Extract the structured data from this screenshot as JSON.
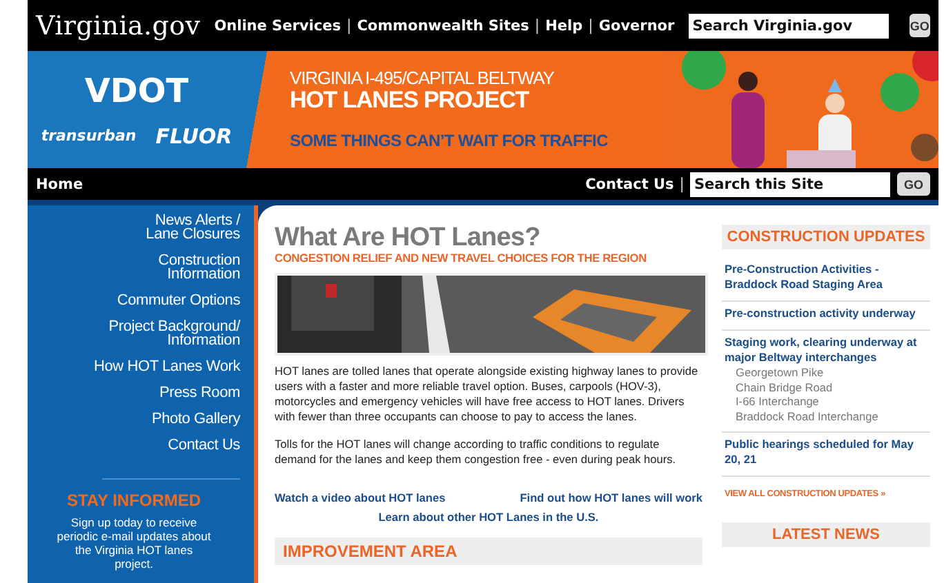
{
  "top_bar": {
    "logo": "Virginia.gov",
    "separator": "|",
    "links": [
      "Online Services",
      "Commonwealth Sites",
      "Help",
      "Governor"
    ],
    "search": {
      "placeholder": "Search Virginia.gov"
    },
    "go": "GO"
  },
  "banner": {
    "logos": [
      {
        "kind": "vdot",
        "text": "VDOT"
      },
      {
        "kind": "transurban",
        "text": "transurban"
      },
      {
        "kind": "fluor",
        "text": "FLUOR"
      }
    ],
    "kicker": "VIRGINIA I-495/CAPITAL BELTWAY",
    "headline": "HOT LANES PROJECT",
    "tagline": "SOME THINGS CAN’T WAIT FOR TRAFFIC",
    "picture": {
      "kind": "picture"
    }
  },
  "nav_bar": {
    "home": "Home",
    "contact": "Contact Us",
    "separator": "|",
    "search": {
      "placeholder": "Search this Site"
    },
    "go": "GO"
  },
  "sidebar": {
    "items": [
      [
        "News Alerts /",
        "Lane Closures"
      ],
      [
        "Construction",
        "Information"
      ],
      [
        "Commuter Options"
      ],
      [
        "Project Background/",
        "Information"
      ],
      [
        "How HOT Lanes Work"
      ],
      [
        "Press Room"
      ],
      [
        "Photo Gallery"
      ],
      [
        "Contact Us"
      ]
    ],
    "stay_informed": {
      "title": "STAY INFORMED",
      "text": "Sign up today to receive periodic e-mail updates about the Virginia HOT lanes project."
    }
  },
  "main": {
    "title": "What Are HOT Lanes?",
    "subtitle": "CONGESTION RELIEF AND NEW TRAVEL CHOICES FOR THE REGION",
    "picture": {
      "kind": "picture"
    },
    "paragraphs": [
      "HOT lanes are tolled lanes that operate alongside existing highway lanes to provide users with a faster and more reliable travel option. Buses, carpools (HOV-3), motorcycles and emergency vehicles will have free access to HOT lanes. Drivers with fewer than three occupants can choose to pay to access the lanes.",
      "Tolls for the HOT lanes will change according to traffic conditions to regulate demand for the lanes and keep them congestion free - even during peak hours."
    ],
    "links": [
      "Watch a video about HOT lanes",
      "Find out how HOT lanes will work",
      "Learn about other HOT Lanes in the U.S."
    ],
    "section_heading": "IMPROVEMENT AREA"
  },
  "right": {
    "heading": "CONSTRUCTION UPDATES",
    "updates": [
      {
        "title": "Pre-Construction Activities - Braddock Road Staging Area"
      },
      {
        "title": "Pre-construction activity underway"
      },
      {
        "title": "Staging work, clearing underway at major Beltway interchanges",
        "subitems": [
          "Georgetown Pike",
          "Chain Bridge Road",
          "I-66 Interchange",
          "Braddock Road Interchange"
        ]
      },
      {
        "title": "Public hearings scheduled for May 20, 21"
      }
    ],
    "view_all": "VIEW ALL CONSTRUCTION UPDATES",
    "view_all_arrow": "»",
    "latest_heading": "LATEST NEWS"
  }
}
